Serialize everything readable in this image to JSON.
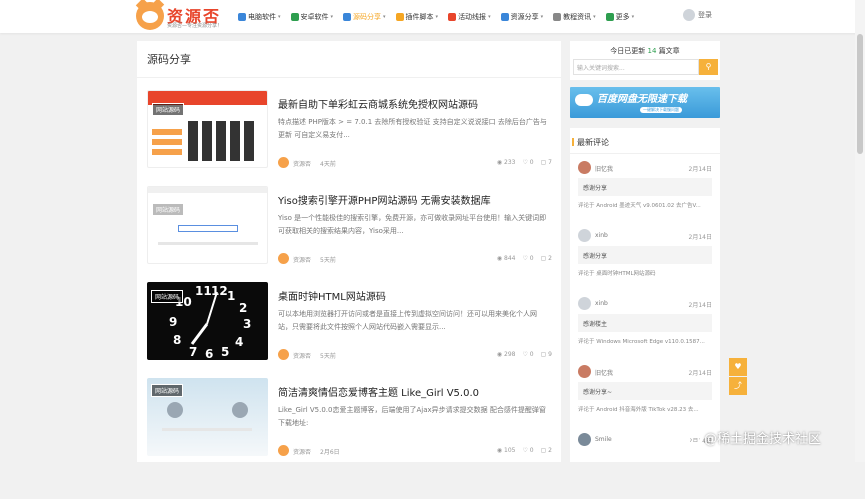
{
  "logo": {
    "title": "资源否",
    "slogan": "资源否—专注资源分享！"
  },
  "nav": [
    {
      "label": "电脑软件",
      "icon": "computer-icon",
      "color": "#3a86d9"
    },
    {
      "label": "安卓软件",
      "icon": "android-icon",
      "color": "#2e9e4f"
    },
    {
      "label": "源码分享",
      "icon": "code-icon",
      "color": "#3a86d9",
      "active": true
    },
    {
      "label": "插件脚本",
      "icon": "plugin-icon",
      "color": "#f5a623"
    },
    {
      "label": "活动线报",
      "icon": "activity-icon",
      "color": "#e8452b"
    },
    {
      "label": "资源分享",
      "icon": "send-icon",
      "color": "#3a86d9"
    },
    {
      "label": "教程资讯",
      "icon": "gear-icon",
      "color": "#888888"
    },
    {
      "label": "更多",
      "icon": "grid-icon",
      "color": "#2e9e4f"
    }
  ],
  "login": {
    "label": "登录"
  },
  "main": {
    "title": "源码分享"
  },
  "posts": [
    {
      "title": "最新自助下单彩虹云商城系统免授权网站源码",
      "excerpt": "特点描述 PHP版本 > = 7.0.1 去除所有授权验证 支持自定义说说接口 去除后台广告与更新 可自定义易支付...",
      "author": "资源否",
      "date": "4天前",
      "views": "233",
      "likes": "0",
      "comments": "7",
      "badge": "网站源码"
    },
    {
      "title": "Yiso搜索引擎开源PHP网站源码 无需安装数据库",
      "excerpt": "Yiso 是一个性能极佳的搜索引擎，免费开源，亦可做收录网址平台使用！输入关键词即可获取相关的搜索结果内容，Yiso采用...",
      "author": "资源否",
      "date": "5天前",
      "views": "844",
      "likes": "0",
      "comments": "2",
      "badge": "网站源码"
    },
    {
      "title": "桌面时钟HTML网站源码",
      "excerpt": "可以本地用浏览器打开访问或者是直接上传到虚拟空间访问！还可以用来美化个人网站，只需要将此文件按照个人网站代码嵌入需要显示...",
      "author": "资源否",
      "date": "5天前",
      "views": "298",
      "likes": "0",
      "comments": "9",
      "badge": "网站源码"
    },
    {
      "title": "简洁清爽情侣恋爱博客主题 Like_Girl V5.0.0",
      "excerpt": "Like_Girl V5.0.0恋爱主题博客，后端使用了Ajax异步请求提交数据 配合感件提醒弹窗 下载地址:",
      "author": "资源否",
      "date": "2月6日",
      "views": "105",
      "likes": "0",
      "comments": "2",
      "badge": "网站源码"
    }
  ],
  "sidebar": {
    "today_prefix": "今日已更新",
    "today_count": "14",
    "today_suffix": "篇文章",
    "search_placeholder": "输入关键词搜索...",
    "banner_title": "百度网盘无限速下载",
    "banner_sub": "一键解决下载慢问题",
    "comments_title": "最新评论",
    "comments": [
      {
        "name": "旧忆我",
        "date": "2月14日",
        "text": "感谢分享",
        "on": "评论于 Android 墨迹天气 v9.0601.02 去广告V..."
      },
      {
        "name": "xinb",
        "date": "2月14日",
        "text": "感谢分享",
        "on": "评论于 桌面时钟HTML网站源码"
      },
      {
        "name": "xinb",
        "date": "2月14日",
        "text": "感谢楼主",
        "on": "评论于 Windows Microsoft Edge v110.0.1587..."
      },
      {
        "name": "旧忆我",
        "date": "2月14日",
        "text": "感谢分享~",
        "on": "评论于 Android 抖音海外版 TikTok v28.23 去..."
      },
      {
        "name": "Smile",
        "date": "2月14日",
        "text": "",
        "on": ""
      }
    ]
  },
  "watermark": "@稀土掘金技术社区"
}
